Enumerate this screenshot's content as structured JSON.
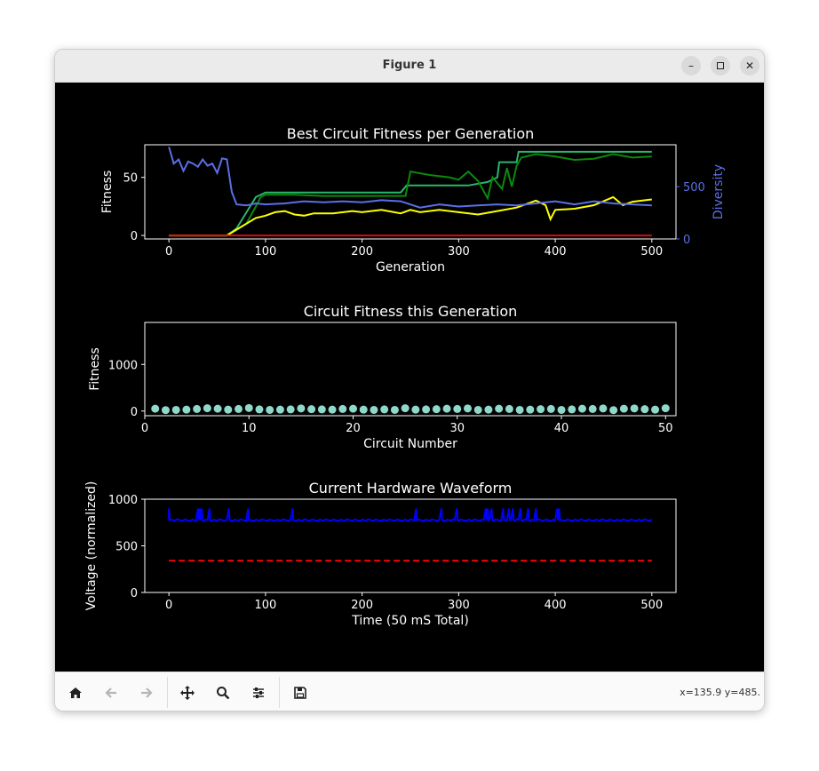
{
  "window": {
    "title": "Figure 1",
    "minimize_label": "–",
    "maximize_label": "□",
    "close_label": "✕"
  },
  "toolbar": {
    "buttons": [
      {
        "name": "home-icon",
        "enabled": true
      },
      {
        "name": "back-icon",
        "enabled": false
      },
      {
        "name": "forward-icon",
        "enabled": false
      },
      {
        "name": "pan-icon",
        "enabled": true
      },
      {
        "name": "zoom-icon",
        "enabled": true
      },
      {
        "name": "configure-subplots-icon",
        "enabled": true
      },
      {
        "name": "save-icon",
        "enabled": true
      }
    ],
    "coords": "x=135.9 y=485."
  },
  "colors": {
    "diversity": "#5b6fe6",
    "grid_text": "#ffffff"
  },
  "chart_data": [
    {
      "type": "line",
      "title": "Best Circuit Fitness per Generation",
      "xlabel": "Generation",
      "ylabel": "Fitness",
      "y2label": "Diversity",
      "xlim": [
        -25,
        525
      ],
      "ylim": [
        -3,
        78
      ],
      "y2lim": [
        0,
        900
      ],
      "xticks": [
        0,
        100,
        200,
        300,
        400,
        500
      ],
      "yticks": [
        0,
        50
      ],
      "y2ticks": [
        0,
        500
      ],
      "series": [
        {
          "color": "#2bb56c",
          "axis": "left",
          "points": [
            [
              0,
              0
            ],
            [
              60,
              0
            ],
            [
              70,
              6
            ],
            [
              90,
              33
            ],
            [
              100,
              37
            ],
            [
              240,
              37
            ],
            [
              246,
              43
            ],
            [
              310,
              43
            ],
            [
              330,
              46
            ],
            [
              340,
              50
            ],
            [
              342,
              63
            ],
            [
              360,
              63
            ],
            [
              362,
              72
            ],
            [
              500,
              72
            ]
          ]
        },
        {
          "color": "#0b8a0b",
          "axis": "left",
          "points": [
            [
              0,
              0
            ],
            [
              60,
              0
            ],
            [
              70,
              5
            ],
            [
              80,
              10
            ],
            [
              90,
              25
            ],
            [
              95,
              33
            ],
            [
              100,
              35
            ],
            [
              130,
              35
            ],
            [
              160,
              34
            ],
            [
              200,
              34
            ],
            [
              230,
              34
            ],
            [
              245,
              34
            ],
            [
              250,
              55
            ],
            [
              270,
              52
            ],
            [
              290,
              50
            ],
            [
              300,
              48
            ],
            [
              310,
              55
            ],
            [
              320,
              47
            ],
            [
              330,
              32
            ],
            [
              335,
              50
            ],
            [
              345,
              40
            ],
            [
              350,
              58
            ],
            [
              355,
              42
            ],
            [
              360,
              60
            ],
            [
              365,
              67
            ],
            [
              380,
              70
            ],
            [
              400,
              68
            ],
            [
              420,
              65
            ],
            [
              440,
              66
            ],
            [
              460,
              70
            ],
            [
              480,
              67
            ],
            [
              500,
              68
            ]
          ]
        },
        {
          "color": "#ffff00",
          "axis": "left",
          "points": [
            [
              0,
              0
            ],
            [
              60,
              0
            ],
            [
              70,
              5
            ],
            [
              90,
              15
            ],
            [
              100,
              17
            ],
            [
              110,
              20
            ],
            [
              120,
              21
            ],
            [
              130,
              18
            ],
            [
              140,
              17
            ],
            [
              150,
              19
            ],
            [
              170,
              19
            ],
            [
              190,
              21
            ],
            [
              200,
              20
            ],
            [
              220,
              22
            ],
            [
              240,
              19
            ],
            [
              250,
              22
            ],
            [
              260,
              20
            ],
            [
              280,
              22
            ],
            [
              300,
              20
            ],
            [
              320,
              18
            ],
            [
              340,
              21
            ],
            [
              360,
              24
            ],
            [
              380,
              30
            ],
            [
              390,
              26
            ],
            [
              395,
              14
            ],
            [
              400,
              22
            ],
            [
              420,
              23
            ],
            [
              440,
              26
            ],
            [
              460,
              33
            ],
            [
              470,
              26
            ],
            [
              480,
              29
            ],
            [
              500,
              31
            ]
          ]
        },
        {
          "color": "#d01010",
          "axis": "left",
          "points": [
            [
              0,
              0
            ],
            [
              500,
              0
            ]
          ]
        },
        {
          "color": "#5b6fe6",
          "axis": "right",
          "points": [
            [
              0,
              880
            ],
            [
              5,
              720
            ],
            [
              10,
              760
            ],
            [
              15,
              650
            ],
            [
              20,
              740
            ],
            [
              25,
              720
            ],
            [
              30,
              690
            ],
            [
              35,
              760
            ],
            [
              40,
              700
            ],
            [
              45,
              720
            ],
            [
              50,
              630
            ],
            [
              55,
              770
            ],
            [
              60,
              760
            ],
            [
              65,
              450
            ],
            [
              70,
              330
            ],
            [
              80,
              320
            ],
            [
              90,
              340
            ],
            [
              100,
              330
            ],
            [
              120,
              340
            ],
            [
              140,
              360
            ],
            [
              160,
              350
            ],
            [
              180,
              360
            ],
            [
              200,
              350
            ],
            [
              220,
              370
            ],
            [
              240,
              360
            ],
            [
              260,
              300
            ],
            [
              280,
              330
            ],
            [
              300,
              310
            ],
            [
              320,
              320
            ],
            [
              340,
              330
            ],
            [
              360,
              320
            ],
            [
              380,
              340
            ],
            [
              400,
              360
            ],
            [
              420,
              330
            ],
            [
              440,
              360
            ],
            [
              460,
              340
            ],
            [
              480,
              330
            ],
            [
              500,
              320
            ]
          ]
        }
      ]
    },
    {
      "type": "scatter",
      "title": "Circuit Fitness this Generation",
      "xlabel": "Circuit Number",
      "ylabel": "Fitness",
      "xlim": [
        0,
        51
      ],
      "ylim": [
        -100,
        1900
      ],
      "xticks": [
        0,
        10,
        20,
        30,
        40,
        50
      ],
      "yticks": [
        0,
        1000
      ],
      "color": "#8fd9cc",
      "x": [
        1,
        2,
        3,
        4,
        5,
        6,
        7,
        8,
        9,
        10,
        11,
        12,
        13,
        14,
        15,
        16,
        17,
        18,
        19,
        20,
        21,
        22,
        23,
        24,
        25,
        26,
        27,
        28,
        29,
        30,
        31,
        32,
        33,
        34,
        35,
        36,
        37,
        38,
        39,
        40,
        41,
        42,
        43,
        44,
        45,
        46,
        47,
        48,
        49,
        50
      ],
      "y": [
        50,
        20,
        25,
        30,
        45,
        60,
        50,
        30,
        45,
        65,
        35,
        25,
        30,
        35,
        55,
        40,
        35,
        30,
        45,
        50,
        30,
        25,
        35,
        25,
        60,
        30,
        35,
        40,
        50,
        45,
        55,
        25,
        30,
        50,
        45,
        25,
        30,
        40,
        45,
        25,
        35,
        50,
        45,
        55,
        20,
        50,
        55,
        40,
        30,
        60
      ]
    },
    {
      "type": "line",
      "title": "Current Hardware Waveform",
      "xlabel": "Time (50 mS Total)",
      "ylabel": "Voltage (normalized)",
      "xlim": [
        -25,
        525
      ],
      "ylim": [
        0,
        1000
      ],
      "xticks": [
        0,
        100,
        200,
        300,
        400,
        500
      ],
      "yticks": [
        0,
        500,
        1000
      ],
      "series": [
        {
          "color": "#0000ff",
          "style": "solid",
          "base": 775,
          "spikes": [
            0,
            30,
            33,
            35,
            43,
            62,
            82,
            128,
            257,
            283,
            299,
            328,
            331,
            335,
            346,
            353,
            356,
            365,
            372,
            381,
            402,
            405
          ],
          "spike_height": 900
        },
        {
          "color": "#ff0000",
          "style": "dashed",
          "points": [
            [
              0,
              340
            ],
            [
              500,
              340
            ]
          ]
        }
      ]
    }
  ]
}
